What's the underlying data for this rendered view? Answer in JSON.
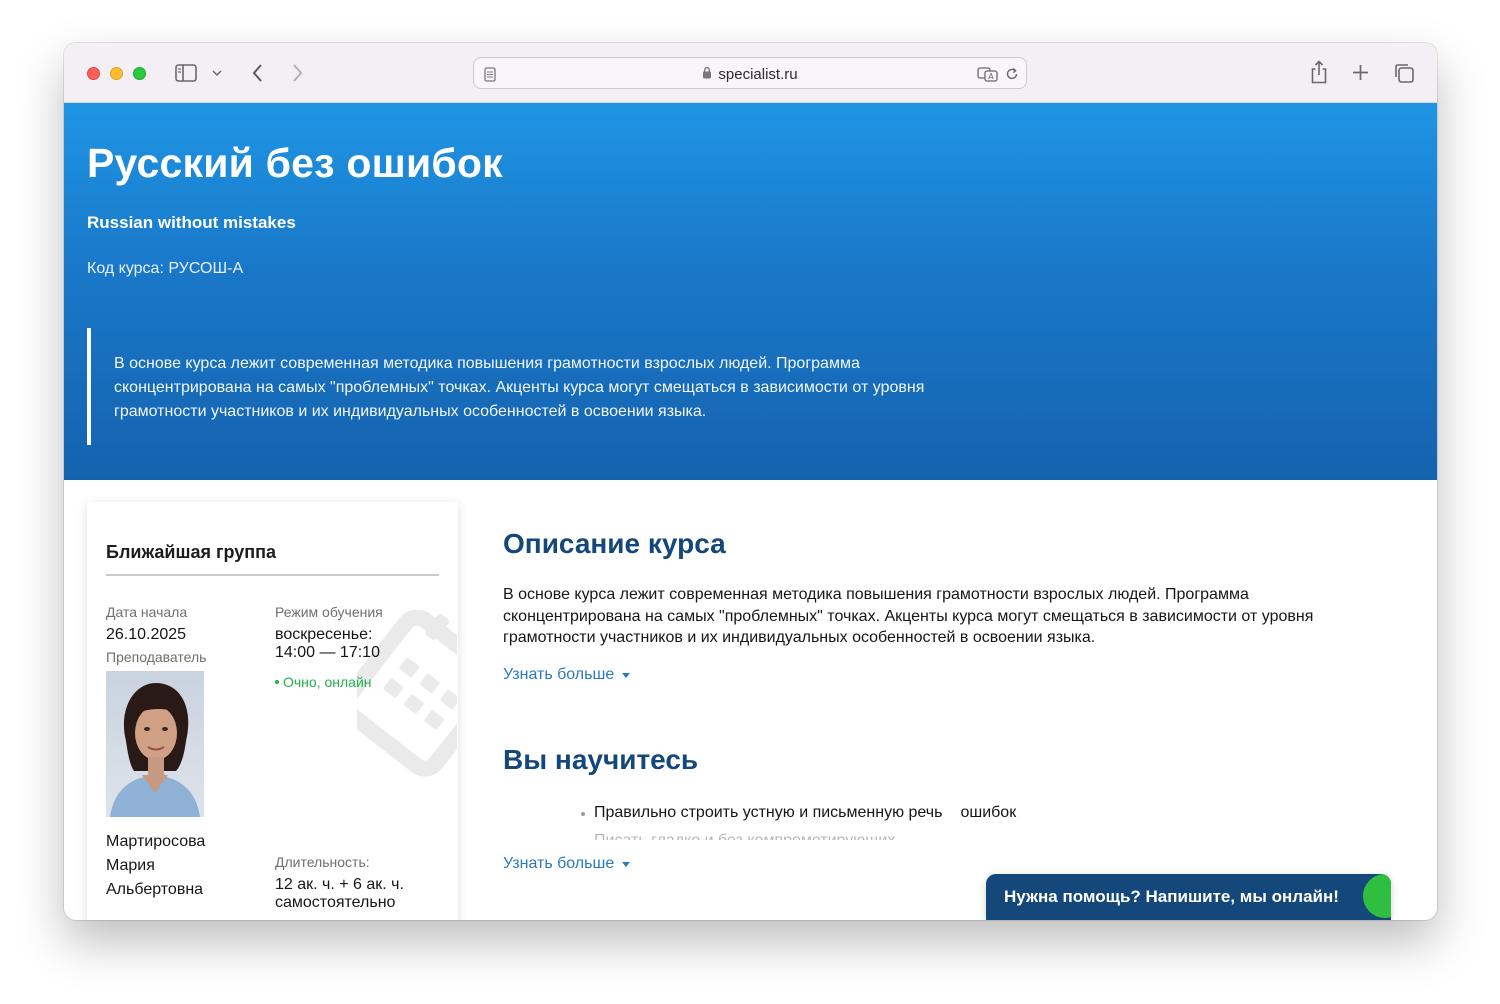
{
  "browser": {
    "url": "specialist.ru"
  },
  "hero": {
    "title": "Русский без ошибок",
    "subtitle": "Russian without mistakes",
    "code": "Код курса: РУСОШ-А",
    "quote": "В основе курса лежит современная методика повышения грамотности взрослых людей. Программа сконцентрирована на самых \"проблемных\" точках. Акценты курса могут смещаться в зависимости от уровня грамотности участников и их индивидуальных особенностей в освоении языка."
  },
  "group_card": {
    "title": "Ближайшая группа",
    "start_label": "Дата начала",
    "start_value": "26.10.2025",
    "mode_label": "Режим обучения",
    "schedule_line1": "воскресенье:",
    "schedule_line2": "14:00 — 17:10",
    "format": "Очно, онлайн",
    "teacher_label": "Преподаватель",
    "teacher_name": "Мартиросова Мария Альбертовна",
    "duration_label": "Длительность:",
    "duration_line1": "12 ак. ч. + 6 ак. ч.",
    "duration_line2": "самостоятельно"
  },
  "description": {
    "title": "Описание курса",
    "text": "В основе курса лежит современная методика повышения грамотности взрослых людей. Программа сконцентрирована на самых \"проблемных\" точках. Акценты курса могут смещаться в зависимости от уровня грамотности участников и их индивидуальных особенностей в освоении языка.",
    "more_label": "Узнать больше"
  },
  "learn": {
    "title": "Вы научитесь",
    "item1_a": "Правильно строить устную и письменную речь",
    "item1_b": "ошибок",
    "item2": "Писать гладко и без компрометирующих",
    "more_label": "Узнать больше"
  },
  "chat": {
    "label": "Нужна помощь? Напишите, мы онлайн!",
    "accent_color": "#2fbe3f",
    "bg_color": "#14477a"
  },
  "colors": {
    "hero_top": "#1e95e4",
    "hero_bottom": "#1463ae",
    "title_color": "#14477a",
    "link_color": "#2a7ac2"
  }
}
